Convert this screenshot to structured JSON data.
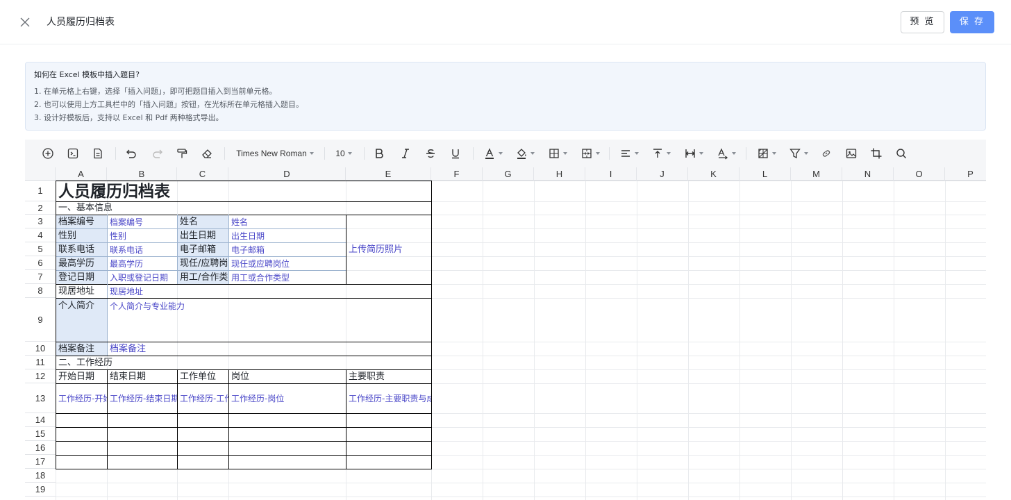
{
  "header": {
    "title": "人员履历归档表",
    "preview_label": "预 览",
    "save_label": "保 存"
  },
  "tips": {
    "title": "如何在 Excel 模板中插入题目?",
    "lines": [
      "1. 在单元格上右键，选择「插入问题」，即可把题目插入到当前单元格。",
      "2. 也可以使用上方工具栏中的「插入问题」按钮，在光标所在单元格插入题目。",
      "3. 设计好模板后，支持以 Excel 和 Pdf 两种格式导出。"
    ]
  },
  "toolbar": {
    "font_family": "Times New Roman",
    "font_size": "10",
    "icons": [
      "insert-question-icon",
      "formula-icon",
      "document-icon",
      "undo-icon",
      "redo-icon",
      "format-painter-icon",
      "eraser-icon",
      "bold-icon",
      "italic-icon",
      "strikethrough-icon",
      "underline-icon",
      "font-color-icon",
      "fill-color-icon",
      "border-icon",
      "merge-cells-icon",
      "horizontal-align-icon",
      "vertical-align-icon",
      "text-wrap-icon",
      "text-rotate-icon",
      "conditional-format-icon",
      "filter-icon",
      "link-icon",
      "image-icon",
      "crop-icon",
      "search-icon"
    ]
  },
  "sheet": {
    "columns": [
      "A",
      "B",
      "C",
      "D",
      "E",
      "F",
      "G",
      "H",
      "I",
      "J",
      "K",
      "L",
      "M",
      "N",
      "O",
      "P"
    ],
    "rows": [
      "1",
      "2",
      "3",
      "4",
      "5",
      "6",
      "7",
      "8",
      "9",
      "10",
      "11",
      "12",
      "13",
      "14",
      "15",
      "16",
      "17",
      "18",
      "19"
    ],
    "cells": {
      "title": "人员履历归档表",
      "section1": "一、基本信息",
      "label_file_no": "档案编号",
      "value_file_no": "档案编号",
      "label_name": "姓名",
      "value_name": "姓名",
      "label_gender": "性别",
      "value_gender": "性别",
      "label_birth": "出生日期",
      "value_birth": "出生日期",
      "label_phone": "联系电话",
      "value_phone": "联系电话",
      "label_email": "电子邮箱",
      "value_email": "电子邮箱",
      "label_edu": "最高学历",
      "value_edu": "最高学历",
      "label_post": "现任/应聘岗位",
      "value_post": "现任或应聘岗位",
      "label_reg": "登记日期",
      "value_reg": "入职或登记日期",
      "label_emp": "用工/合作类型",
      "value_emp": "用工或合作类型",
      "photo": "上传简历照片",
      "label_addr": "现居地址",
      "value_addr": "现居地址",
      "label_intro": "个人简介",
      "value_intro": "个人简介与专业能力",
      "label_note": "档案备注",
      "value_note": "档案备注",
      "section2": "二、工作经历",
      "h_start": "开始日期",
      "h_end": "结束日期",
      "h_unit": "工作单位",
      "h_pos": "岗位",
      "h_duty": "主要职责",
      "w_start": "工作经历-开始日期",
      "w_end": "工作经历-结束日期",
      "w_unit": "工作经历-工作单位",
      "w_pos": "工作经历-岗位",
      "w_duty": "工作经历-主要职责与成果"
    }
  }
}
